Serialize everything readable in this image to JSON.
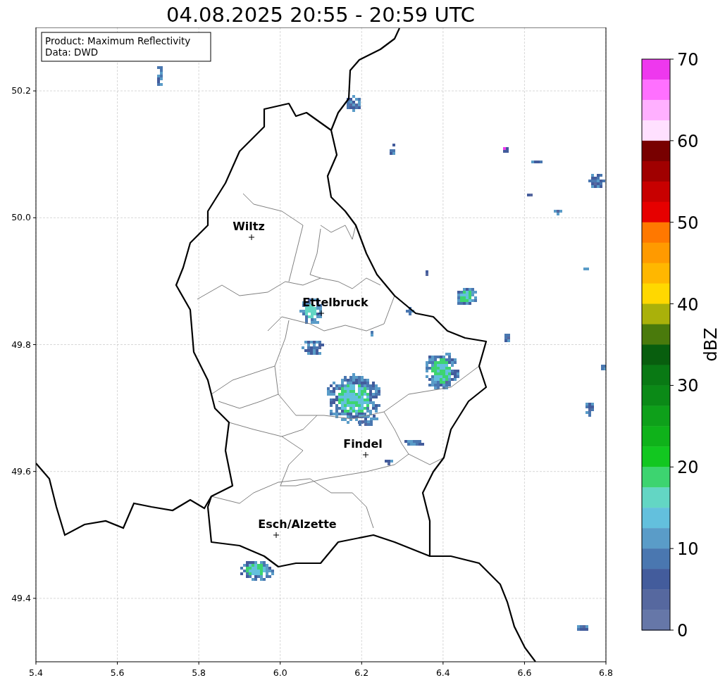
{
  "title": "04.08.2025 20:55 - 20:59 UTC",
  "info_box": [
    "Product: Maximum Reflectivity",
    "Data: DWD"
  ],
  "map": {
    "x_ticks": [
      "5.4",
      "5.6",
      "5.8",
      "6.0",
      "6.2",
      "6.4",
      "6.6",
      "6.8"
    ],
    "y_ticks": [
      "50.2",
      "50.0",
      "49.8",
      "49.6",
      "49.4"
    ],
    "cities": [
      {
        "name": "Wiltz"
      },
      {
        "name": "Ettelbruck"
      },
      {
        "name": "Findel"
      },
      {
        "name": "Esch/Alzette"
      }
    ]
  },
  "colorbar": {
    "label": "dBZ",
    "ticks": [
      "70",
      "60",
      "50",
      "40",
      "30",
      "20",
      "10",
      "0"
    ],
    "bins": [
      {
        "color": "#ee38ee"
      },
      {
        "color": "#ff70ff"
      },
      {
        "color": "#ffb0ff"
      },
      {
        "color": "#ffe0ff"
      },
      {
        "color": "#780000"
      },
      {
        "color": "#a00000"
      },
      {
        "color": "#c80000"
      },
      {
        "color": "#e60000"
      },
      {
        "color": "#ff7800"
      },
      {
        "color": "#ff9a00"
      },
      {
        "color": "#ffb700"
      },
      {
        "color": "#ffd800"
      },
      {
        "color": "#aab10a"
      },
      {
        "color": "#4a7a0c"
      },
      {
        "color": "#085e0e"
      },
      {
        "color": "#097914"
      },
      {
        "color": "#0b8a17"
      },
      {
        "color": "#0ea01a"
      },
      {
        "color": "#0fb21a"
      },
      {
        "color": "#12c720"
      },
      {
        "color": "#3dd470"
      },
      {
        "color": "#63d6c4"
      },
      {
        "color": "#63c0dd"
      },
      {
        "color": "#5a9cc8"
      },
      {
        "color": "#4a77b0"
      },
      {
        "color": "#435c9c"
      },
      {
        "color": "#56689f"
      },
      {
        "color": "#6677a8"
      }
    ]
  }
}
